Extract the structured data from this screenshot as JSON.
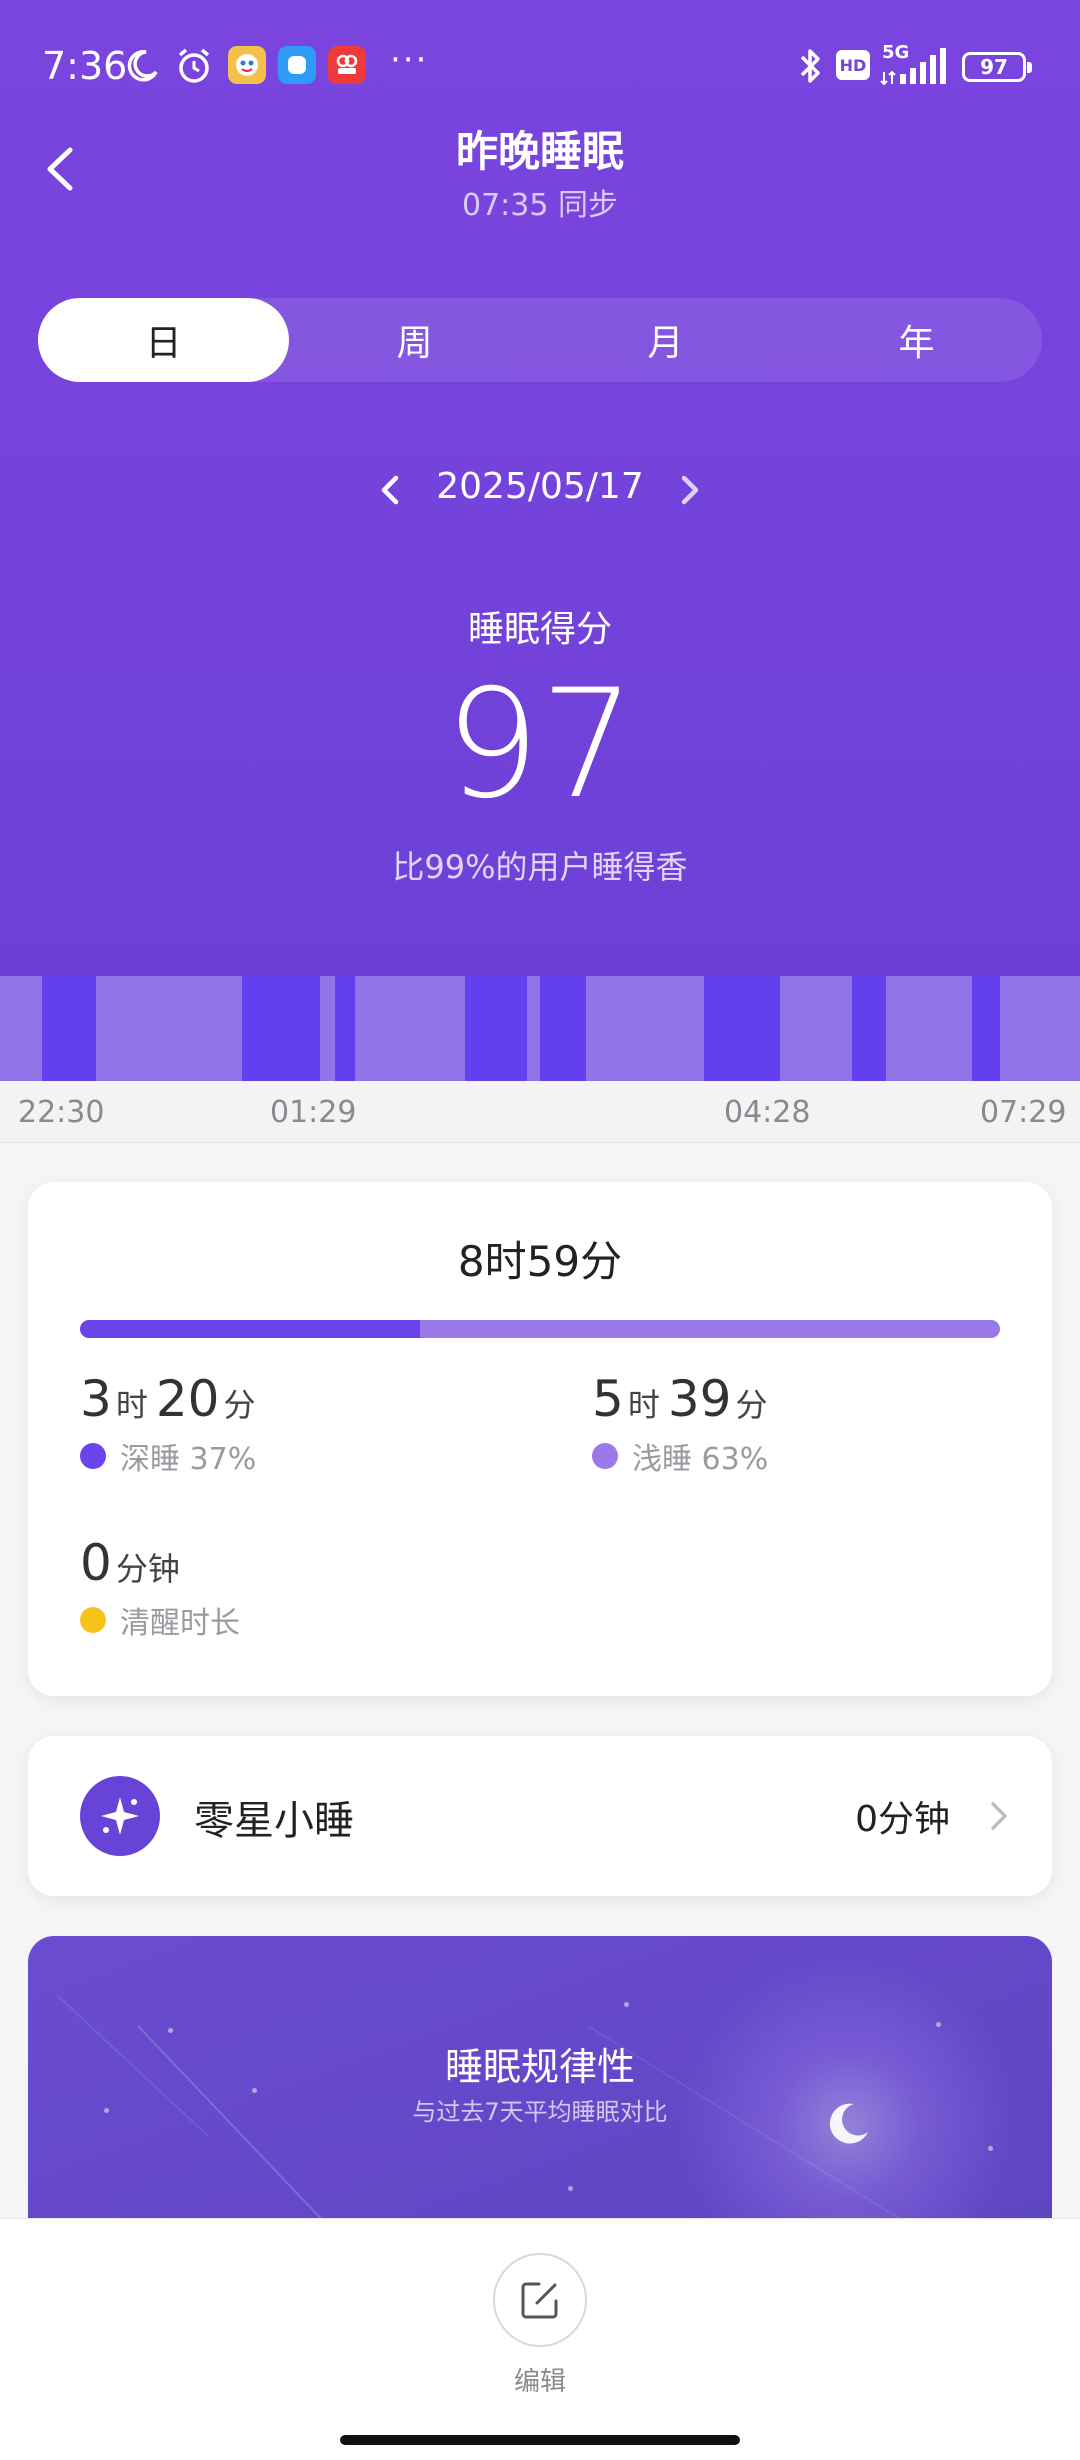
{
  "status_bar": {
    "time": "7:36",
    "dots": "···",
    "network": "5G",
    "hd": "HD",
    "battery": "97",
    "icons": [
      "moon-icon",
      "alarm-icon",
      "app-badge-1",
      "app-badge-2",
      "app-badge-3",
      "bluetooth-icon",
      "hd-icon",
      "signal-icon",
      "battery-icon"
    ]
  },
  "header": {
    "title": "昨晚睡眠",
    "subtitle": "07:35 同步"
  },
  "tabs": [
    {
      "label": "日",
      "active": true
    },
    {
      "label": "周",
      "active": false
    },
    {
      "label": "月",
      "active": false
    },
    {
      "label": "年",
      "active": false
    }
  ],
  "date": "2025/05/17",
  "score": {
    "label": "睡眠得分",
    "value": "97",
    "compare": "比99%的用户睡得香"
  },
  "timeline": {
    "ticks": [
      "22:30",
      "01:29",
      "04:28",
      "07:29"
    ],
    "deep_color": "#6240ee",
    "light_color": "#9374e8"
  },
  "summary": {
    "total": "8时59分",
    "deep_fraction": 0.37,
    "deep": {
      "hours": "3",
      "hour_unit": "时",
      "minutes": "20",
      "minute_unit": "分",
      "label": "深睡 37%",
      "color": "#6a45ec"
    },
    "light": {
      "hours": "5",
      "hour_unit": "时",
      "minutes": "39",
      "minute_unit": "分",
      "label": "浅睡 63%",
      "color": "#9a7ae8"
    },
    "awake": {
      "minutes": "0",
      "unit": "分钟",
      "label": "清醒时长",
      "color": "#f7c21a"
    }
  },
  "nap": {
    "label": "零星小睡",
    "value": "0分钟"
  },
  "regularity": {
    "title": "睡眠规律性",
    "subtitle": "与过去7天平均睡眠对比"
  },
  "bottom": {
    "edit_label": "编辑"
  }
}
